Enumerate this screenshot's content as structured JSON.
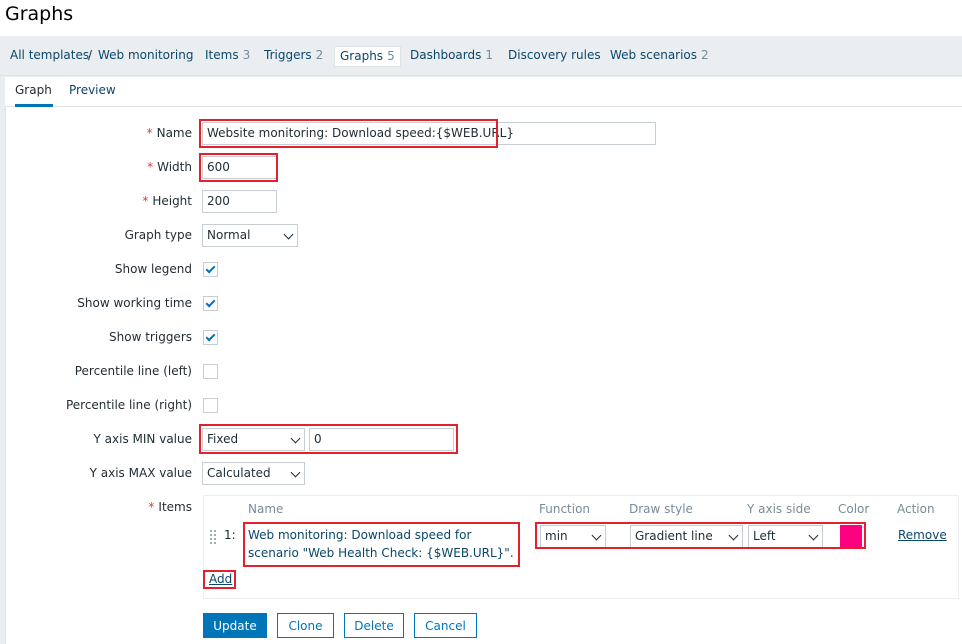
{
  "page": {
    "title": "Graphs"
  },
  "nav": {
    "breadcrumb_all": "All templates",
    "breadcrumb_sep": "/",
    "breadcrumb_template": "Web monitoring",
    "items": {
      "label": "Items",
      "count": "3"
    },
    "triggers": {
      "label": "Triggers",
      "count": "2"
    },
    "graphs": {
      "label": "Graphs",
      "count": "5"
    },
    "dashboards": {
      "label": "Dashboards",
      "count": "1"
    },
    "discovery": {
      "label": "Discovery rules"
    },
    "webscenarios": {
      "label": "Web scenarios",
      "count": "2"
    }
  },
  "tabs": {
    "graph": "Graph",
    "preview": "Preview"
  },
  "form": {
    "name": {
      "label": "Name",
      "value": "Website monitoring: Download speed:{$WEB.URL}"
    },
    "width": {
      "label": "Width",
      "value": "600"
    },
    "height": {
      "label": "Height",
      "value": "200"
    },
    "graph_type": {
      "label": "Graph type",
      "value": "Normal"
    },
    "show_legend": {
      "label": "Show legend",
      "checked": true
    },
    "show_working_time": {
      "label": "Show working time",
      "checked": true
    },
    "show_triggers": {
      "label": "Show triggers",
      "checked": true
    },
    "percentile_left": {
      "label": "Percentile line (left)",
      "checked": false
    },
    "percentile_right": {
      "label": "Percentile line (right)",
      "checked": false
    },
    "y_min": {
      "label": "Y axis MIN value",
      "type": "Fixed",
      "value": "0"
    },
    "y_max": {
      "label": "Y axis MAX value",
      "type": "Calculated"
    },
    "items": {
      "label": "Items"
    }
  },
  "items_table": {
    "headers": {
      "name": "Name",
      "function": "Function",
      "draw_style": "Draw style",
      "y_axis_side": "Y axis side",
      "color": "Color",
      "action": "Action"
    },
    "rows": [
      {
        "index": "1:",
        "name": "Web monitoring: Download speed for scenario \"Web Health Check: {$WEB.URL}\".",
        "function": "min",
        "draw_style": "Gradient line",
        "y_axis_side": "Left",
        "color": "#ff0080",
        "action": "Remove"
      }
    ],
    "add_label": "Add"
  },
  "buttons": {
    "update": "Update",
    "clone": "Clone",
    "delete": "Delete",
    "cancel": "Cancel"
  },
  "colors": {
    "link": "#0a466a",
    "accent": "#0275b8",
    "required": "#e33734",
    "highlight": "#e3202d"
  }
}
